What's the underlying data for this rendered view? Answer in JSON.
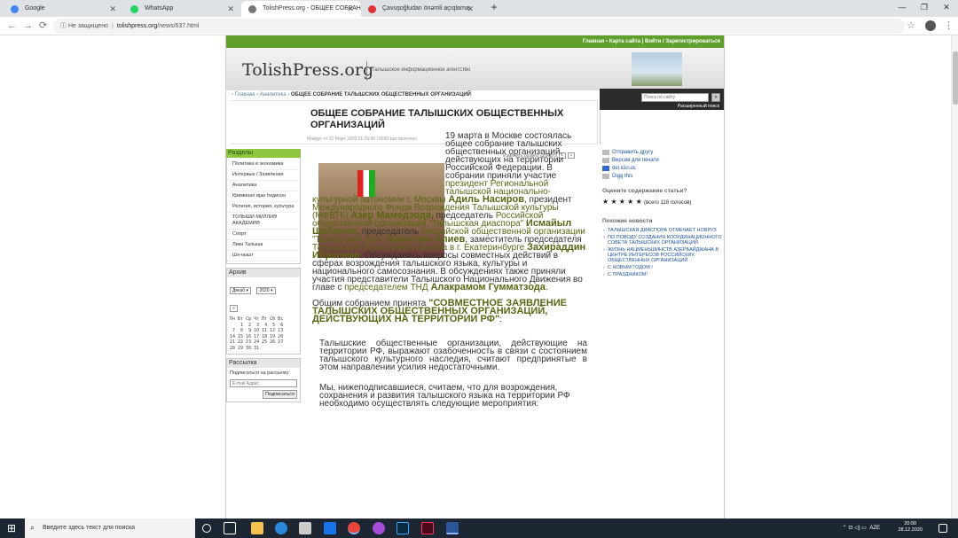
{
  "browser": {
    "tabs": [
      {
        "title": "Google",
        "icon_color": "#4285f4"
      },
      {
        "title": "WhatsApp",
        "icon_color": "#25d366"
      },
      {
        "title": "TolishPress.org - ОБЩЕЕ СОБРАН",
        "icon_color": "#555555"
      },
      {
        "title": "Çavuşoğludan önəmli açıqlama:",
        "icon_color": "#d33"
      }
    ],
    "new_tab": "+",
    "url_security": "Не защищено",
    "url_host": "tolishpress.org",
    "url_path": "/news/637.html",
    "back": "←",
    "forward": "→",
    "reload": "⟳",
    "star": "☆",
    "menu": "⋮",
    "minimize": "—",
    "maximize": "❐",
    "close": "✕"
  },
  "site": {
    "topnav": "Главная  ▪  Карта сайта | Войти / Зарегистрироваться",
    "logo": "TolishPress.org",
    "tagline": "Талышское информационное агентство",
    "search_placeholder": "Поиск по сайту",
    "search_go": "»",
    "advanced_search": "Расширенный поиск",
    "breadcrumb_links": "› Главная › Аналитика ›",
    "breadcrumb_current": "ОБЩЕЕ СОБРАНИЕ ТАЛЫШСКИХ ОБЩЕСТВЕННЫХ ОРГАНИЗАЦИЙ",
    "title": "ОБЩЕЕ СОБРАНИЕ ТАЛЫШСКИХ ОБЩЕСТВЕННЫХ ОРГАНИЗАЦИЙ",
    "meta": "Майдуг от 21 Март 2009 01:25:00 | 5650 раз прочтено",
    "font_size_label": "Изменить размер шрифта",
    "font_minus": "−",
    "font_plus": "+"
  },
  "left": {
    "sections_title": "Разделы",
    "sections": [
      "Политика и экономика",
      "Интервью / Заявление",
      "Аналитика",
      "Криминал ијан һәдисон",
      "Религия, история, культура",
      "ТОЛЫШИ МИЛЛИӘ АКАДЕМИӘ",
      "Спорт",
      "Лики Талыша",
      "Шә-нышт"
    ],
    "archive_title": "Архив",
    "archive_month": "Декаб ▾",
    "archive_year": "2020 ▾",
    "archive_btn": "»",
    "calendar": [
      "Пн Вт Ср Чт Пт Сб Вс",
      "    1  2  3  4  5  6",
      " 7  8  9 10 11 12 13",
      "14 15 16 17 18 19 20",
      "21 22 23 24 25 26 27",
      "28 29 30 31"
    ],
    "mailer_title": "Рассылка",
    "mailer_label": "Подписаться на рассылку:",
    "mailer_placeholder": "E-mail Адрес",
    "mailer_btn": "Подписаться"
  },
  "article": {
    "p1_a": "19 марта в Москве состоялась общее собрание талышских общественных организаций, действующих на территории Российской Федерации. В собрании приняли участие ",
    "p1_b": "президент Региональной талышской национально-культурной автономии г. Москвы",
    "n1": "Адиль Насиров",
    "p1_c": ", президент ",
    "p1_d": "Международного Фонда Возрождения Талышской культуры (МФВТК)",
    "n2": "Азер Мамедзода",
    "p1_e": ", председатель ",
    "p1_f": "Российской общественной организации \"Талышская диаспора\"",
    "n3": "Исмайыл Шабанов",
    "p1_g": ", председатель ",
    "p1_h": "Российской общественной организации \"Талышский дом\"",
    "n4": "Ханоглан Алиев",
    "p1_i": ", заместитель председателя ",
    "p1_j": "Талышского Культурного Центра в г. Екатеринбурге",
    "n5": "Захираддин Ибрагими",
    "p1_k": ". Обсуждались вопросы совместных действий в сферах возрождения талышского языка, культуры и национального самосознания. В обсуждениях также приняли участия представители Талышского Национального Движения во главе с ",
    "p1_l": "председателем ТНД",
    "n6": "Алакрамом Гумматзода",
    "p1_m": ".",
    "p2_a": "Общим собранием принята ",
    "p2_b": "\"СОВМЕСТНОЕ ЗАЯВЛЕНИЕ ТАЛЫШСКИХ ОБЩЕСТВЕННЫХ ОРГАНИЗАЦИЙ, ДЕЙСТВУЮЩИХ НА ТЕРРИТОРИИ РФ\"",
    "p2_c": ":",
    "p3": "Талышские общественные организации, действующие на территории РФ, выражают озабоченность в связи с состоянием талышского культурного наследия, считают предпринятые в этом направлении усилия недостаточными.",
    "p4": "Мы, нижеподписавшиеся, считаем, что для возрождения, сохранения и развития талышского языка на территории РФ необходимо осуществлять следующие мероприятия:"
  },
  "right": {
    "links": [
      "Отправить другу",
      "Версия для печати",
      "del.icio.us",
      "Digg this"
    ],
    "rating_title": "Оцените содержание статьи?",
    "stars": "★ ★ ★ ★ ★",
    "votes": "(всего 118 голосов)",
    "news_title": "Похожие новости",
    "news": [
      "ТАЛЫШСКАЯ ДИАСПОРА ОТМЕЧАЕТ НОВРУЗ",
      "ПО ПОВОДУ СОЗДАНИЯ КООРДИНАЦИОННОГО СОВЕТА ТАЛЫШСКИХ ОРГАНИЗАЦИЙ",
      "ЖИЗНЬ НАЦМЕНЬШИНСТВ АЗЕРБАЙДЖАНА В ЦЕНТРЕ ИНТЕРЕСОВ РОССИЙСКИХ ОБЩЕСТВЕННЫХ ОРГАНИЗАЦИЙ",
      "С НОВЫМ ГОДОМ !",
      "С ПРАЗДНИКОМ!"
    ]
  },
  "taskbar": {
    "search_placeholder": "Введите здесь текст для поиска",
    "lang": "AZE",
    "time": "20:00",
    "date": "28.12.2020",
    "tray_icons": "⌃ ⊡ ◁) ▭"
  },
  "colors": {
    "green": "#5fa02d",
    "article_green": "#5a6614",
    "link_blue": "#1b52a0"
  }
}
